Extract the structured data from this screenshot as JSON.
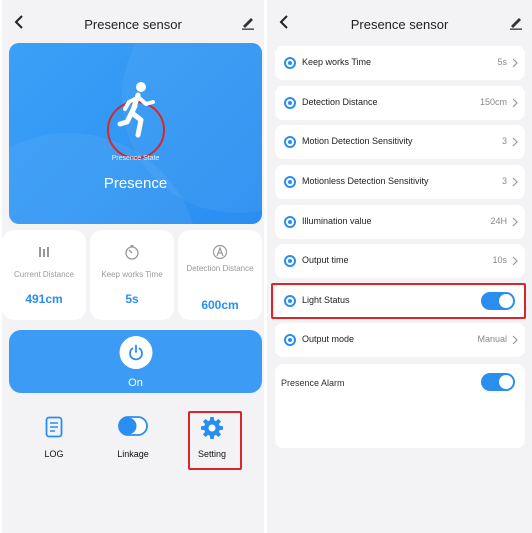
{
  "left": {
    "title": "Presence sensor",
    "hero": {
      "state_label": "Presence State",
      "state_value": "Presence"
    },
    "stats": [
      {
        "icon": "distance-icon",
        "label": "Current Distance",
        "value": "491cm"
      },
      {
        "icon": "timer-icon",
        "label": "Keep works Time",
        "value": "5s"
      },
      {
        "icon": "detection-distance-icon",
        "label": "Detection Distance",
        "value": "600cm"
      }
    ],
    "power": {
      "label": "On"
    },
    "menu": [
      {
        "label": "LOG",
        "icon": "log-icon"
      },
      {
        "label": "Linkage",
        "icon": "linkage-toggle-icon"
      },
      {
        "label": "Setting",
        "icon": "gear-icon"
      }
    ]
  },
  "right": {
    "title": "Presence sensor",
    "rows": [
      {
        "label": "Keep works Time",
        "value": "5s"
      },
      {
        "label": "Detection Distance",
        "value": "150cm"
      },
      {
        "label": "Motion Detection Sensitivity",
        "value": "3"
      },
      {
        "label": "Motionless Detection Sensitivity",
        "value": "3"
      },
      {
        "label": "Illumination value",
        "value": "24H"
      },
      {
        "label": "Output time",
        "value": "10s"
      },
      {
        "label": "Light Status",
        "toggle": true
      },
      {
        "label": "Output mode",
        "value": "Manual"
      }
    ],
    "alarm": {
      "label": "Presence Alarm",
      "toggle": true
    }
  },
  "colors": {
    "accent": "#2a8ef1",
    "highlight": "#d8262a",
    "background": "#f3f3f5"
  }
}
